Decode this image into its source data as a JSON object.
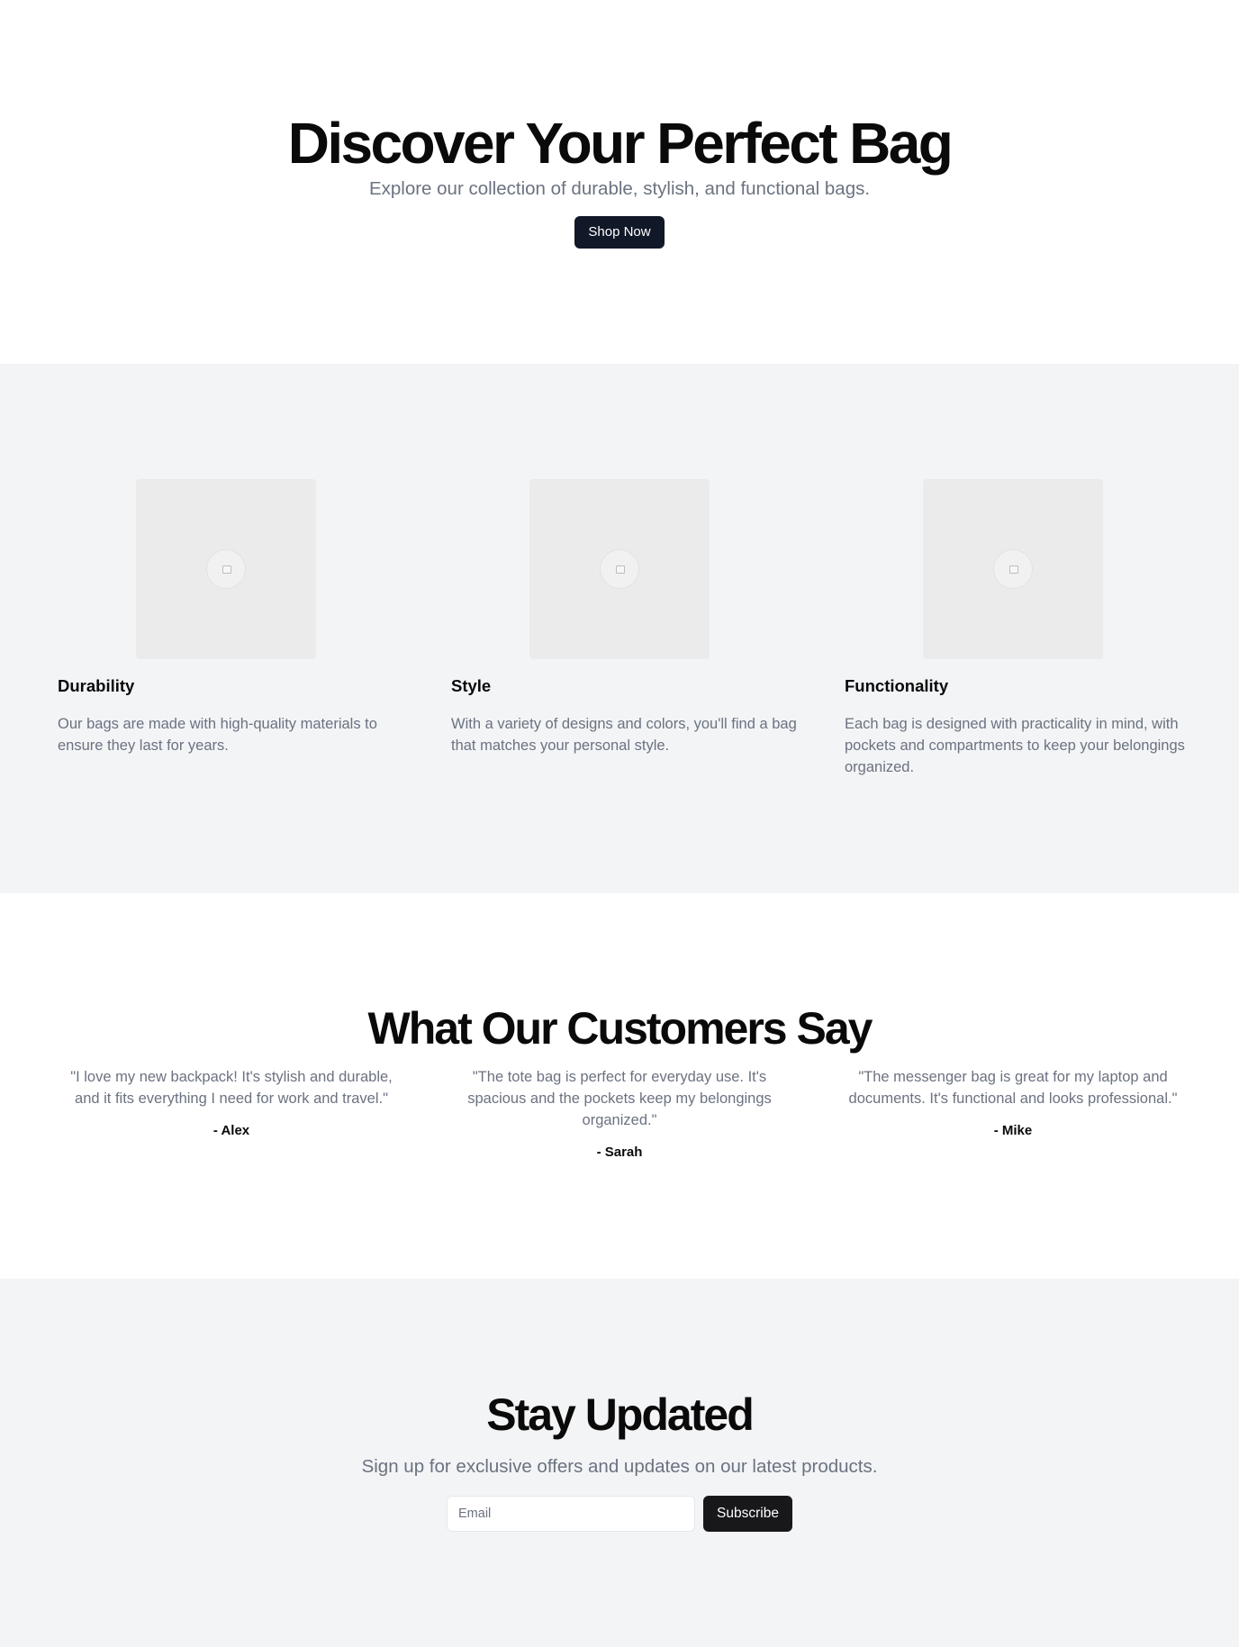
{
  "hero": {
    "title": "Discover Your Perfect Bag",
    "subtitle": "Explore our collection of durable, stylish, and functional bags.",
    "cta_label": "Shop Now"
  },
  "features": [
    {
      "icon": "image-placeholder-icon",
      "title": "Durability",
      "text": "Our bags are made with high-quality materials to ensure they last for years."
    },
    {
      "icon": "image-placeholder-icon",
      "title": "Style",
      "text": "With a variety of designs and colors, you'll find a bag that matches your personal style."
    },
    {
      "icon": "image-placeholder-icon",
      "title": "Functionality",
      "text": "Each bag is designed with practicality in mind, with pockets and compartments to keep your belongings organized."
    }
  ],
  "testimonials": {
    "title": "What Our Customers Say",
    "items": [
      {
        "quote": "\"I love my new backpack! It's stylish and durable, and it fits everything I need for work and travel.\"",
        "author": "- Alex"
      },
      {
        "quote": "\"The tote bag is perfect for everyday use. It's spacious and the pockets keep my belongings organized.\"",
        "author": "- Sarah"
      },
      {
        "quote": "\"The messenger bag is great for my laptop and documents. It's functional and looks professional.\"",
        "author": "- Mike"
      }
    ]
  },
  "newsletter": {
    "title": "Stay Updated",
    "subtitle": "Sign up for exclusive offers and updates on our latest products.",
    "email_placeholder": "Email",
    "email_value": "",
    "submit_label": "Subscribe"
  },
  "colors": {
    "primary_button": "#111827",
    "subscribe_button": "#18181b",
    "muted_text": "#6b7280",
    "section_alt_bg": "#f3f4f6"
  }
}
